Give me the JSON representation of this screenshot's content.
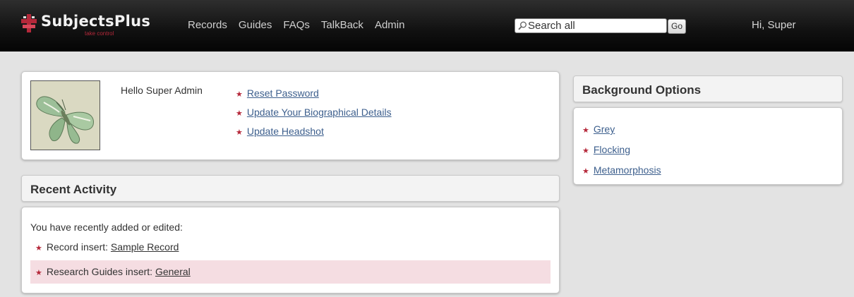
{
  "header": {
    "logo_text": "SubjectsPlus",
    "logo_tagline": "take control",
    "nav": [
      "Records",
      "Guides",
      "FAQs",
      "TalkBack",
      "Admin"
    ],
    "search": {
      "value": "Search all",
      "button": "Go"
    },
    "greeting": "Hi, Super"
  },
  "profile": {
    "hello": "Hello Super Admin",
    "links": [
      "Reset Password",
      "Update Your Biographical Details",
      "Update Headshot"
    ]
  },
  "recent": {
    "title": "Recent Activity",
    "intro": "You have recently added or edited:",
    "items": [
      {
        "prefix": "Record insert:",
        "link": "Sample Record"
      },
      {
        "prefix": "Research Guides insert:",
        "link": "General"
      }
    ]
  },
  "background": {
    "title": "Background Options",
    "options": [
      "Grey",
      "Flocking",
      "Metamorphosis"
    ]
  },
  "colors": {
    "accent": "#b5283a",
    "link": "#3d5f8d",
    "highlight_row": "#f5dde2"
  }
}
